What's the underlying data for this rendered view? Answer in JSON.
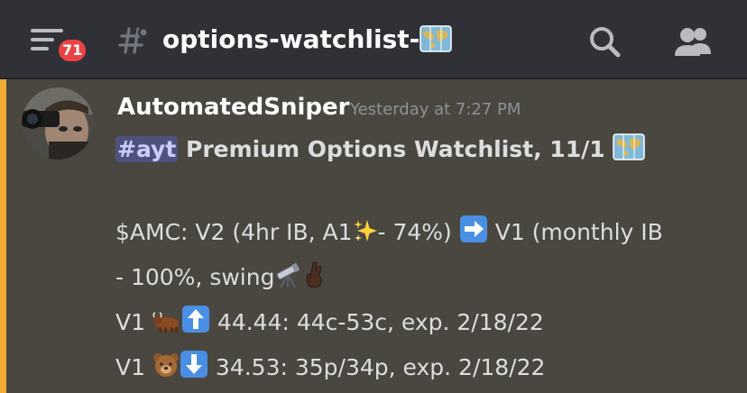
{
  "header": {
    "unread_count": "71",
    "channel_name": "options-watchlist-"
  },
  "icons": {
    "menu": "hamburger-menu-icon",
    "hash": "hashtag-icon",
    "map": "world-map-emoji",
    "search": "search-icon",
    "members": "members-icon"
  },
  "colors": {
    "badge": "#ed4245",
    "mention_bar": "#f2ac31",
    "highlight_bg": "#4a4740",
    "channel_mention": "#5865f2",
    "arrow_emoji": "#4a8fe3"
  },
  "message": {
    "author": "AutomatedSniper",
    "timestamp": "Yesterday at 7:27 PM",
    "mention": "#ayt",
    "title": "Premium Options Watchlist, 11/1",
    "amc_a": "$AMC: V2 (4hr IB, A1",
    "amc_b": "- 74%)",
    "amc_c": "V1 (monthly IB",
    "amc_d": "- 100%, swing",
    "bull_prefix": "V1",
    "bull_text": "44.44: 44c-53c, exp. 2/18/22",
    "bear_prefix": "V1",
    "bear_text": "34.53: 35p/34p, exp. 2/18/22"
  }
}
